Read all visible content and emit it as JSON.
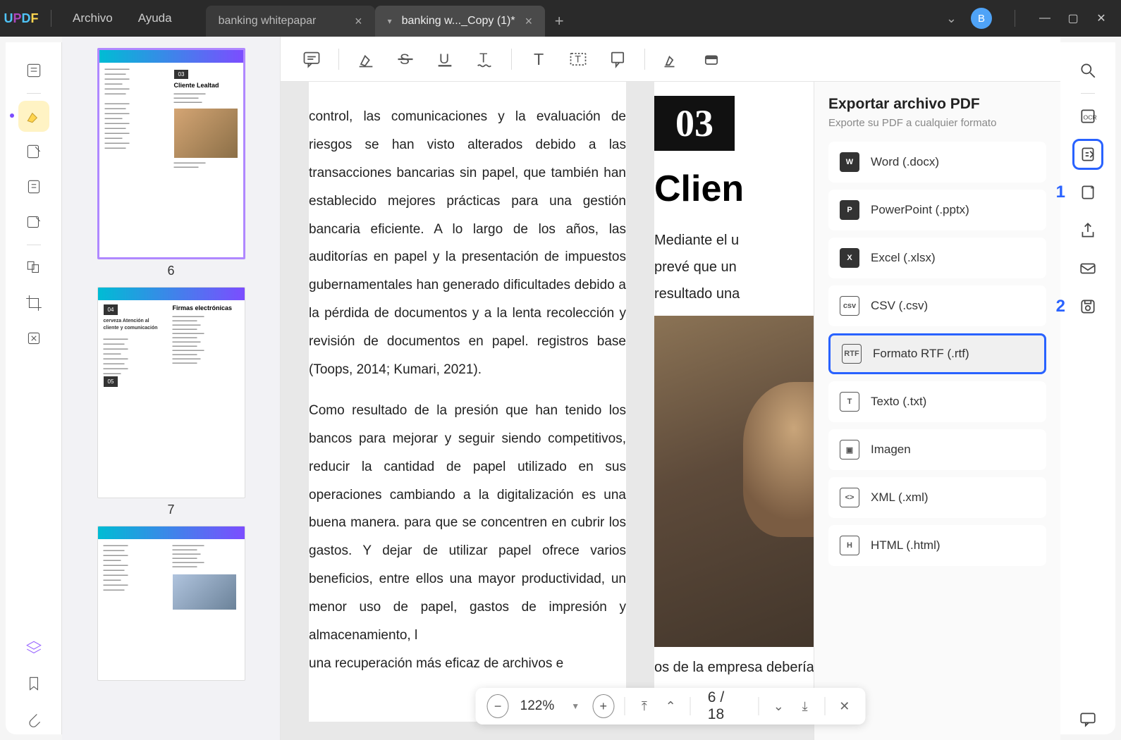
{
  "titlebar": {
    "menu": {
      "archivo": "Archivo",
      "ayuda": "Ayuda"
    },
    "tabs": [
      {
        "label": "banking whitepapar"
      },
      {
        "label": "banking w..._Copy (1)*"
      }
    ],
    "avatar_initial": "B"
  },
  "thumbs": {
    "page6": {
      "num": "6",
      "badge": "03",
      "title": "Cliente Lealtad"
    },
    "page7": {
      "num": "7",
      "badge": "04",
      "badge2": "05",
      "title": "Firmas electrónicas",
      "subtitle": "cerveza Atención al cliente y comunicación"
    }
  },
  "document": {
    "para1": "control, las comunicaciones y la evaluación de riesgos se han visto alterados debido a las transacciones bancarias sin papel, que también han establecido mejores prácticas para una gestión bancaria eficiente. A lo largo de los años, las auditorías en papel y la presentación de impuestos gubernamentales han generado dificultades debido a la pérdida de documentos y a la lenta recolección y revisión de documentos en papel.  registros base (Toops, 2014; Kumari, 2021).",
    "para2a": "Como resultado de la presión que han tenido los bancos para mejorar y seguir siendo competitivos, reducir la cantidad de papel utilizado en sus operaciones cambiando a la digitalización es una buena manera. para que se concentren en cubrir los gastos. Y dejar de utilizar papel ofrece varios beneficios, entre ellos una mayor productividad, un menor uso de papel, gastos de impresión y almacenamiento, l",
    "para2b": "una recuperación más eficaz de archivos e",
    "col2_badge": "03",
    "col2_title": "Clien",
    "col2_text1": "Mediante el u",
    "col2_text2": "prevé que un",
    "col2_text3": "resultado una",
    "col2_tail": "os de la empresa deberían bajar y sus ganancias deberían aumentar."
  },
  "zoombar": {
    "zoom": "122%",
    "page_current": "6",
    "page_sep": "/",
    "page_total": "18"
  },
  "export": {
    "title": "Exportar archivo PDF",
    "subtitle": "Exporte su PDF a cualquier formato",
    "items": {
      "word": "Word (.docx)",
      "ppt": "PowerPoint (.pptx)",
      "xls": "Excel (.xlsx)",
      "csv": "CSV (.csv)",
      "rtf": "Formato RTF (.rtf)",
      "txt": "Texto (.txt)",
      "img": "Imagen",
      "xml": "XML (.xml)",
      "html": "HTML (.html)"
    }
  },
  "callouts": {
    "one": "1",
    "two": "2"
  }
}
